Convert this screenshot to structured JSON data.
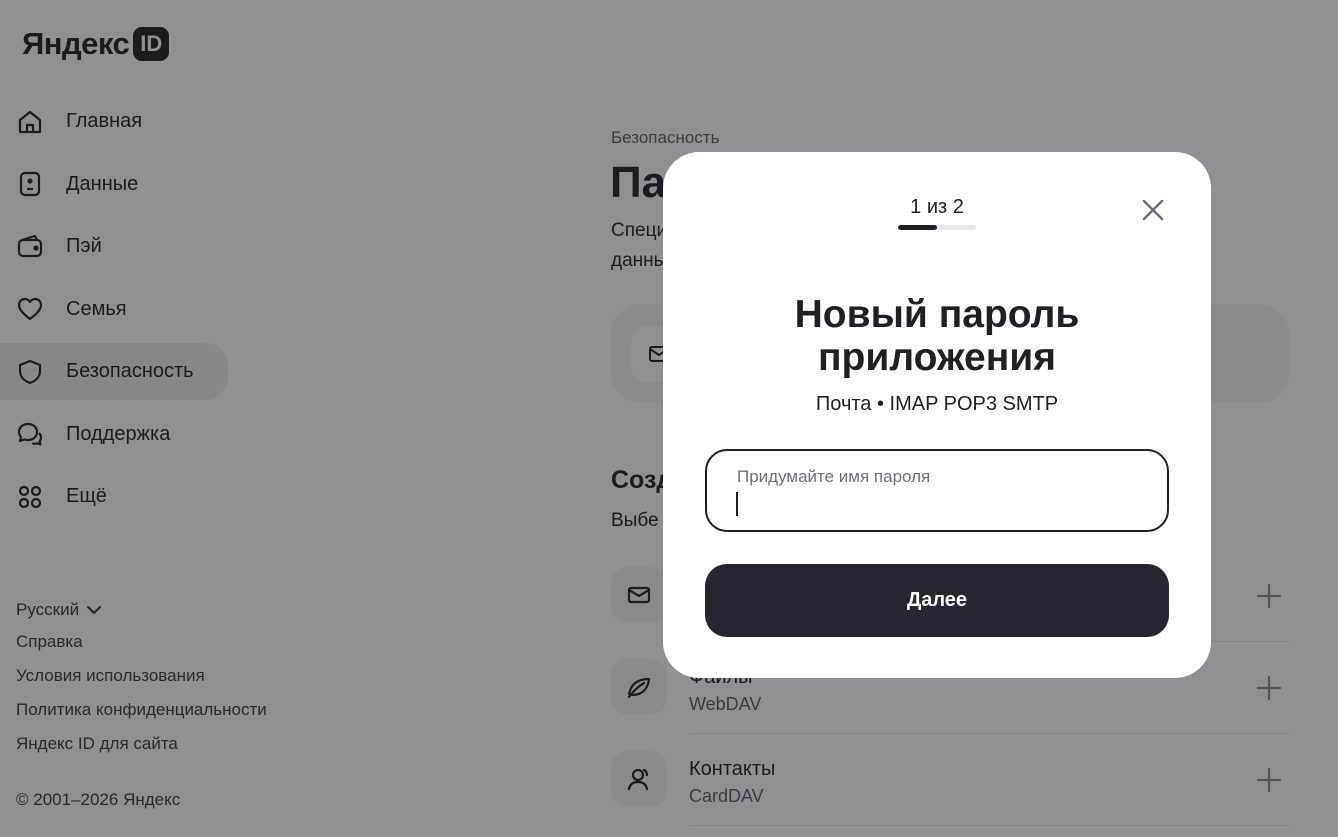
{
  "brand": {
    "wordmark": "Яндекс",
    "badge": "ID"
  },
  "sidebar": {
    "items": [
      {
        "label": "Главная",
        "icon": "home-icon",
        "active": false
      },
      {
        "label": "Данные",
        "icon": "id-card-icon",
        "active": false
      },
      {
        "label": "Пэй",
        "icon": "wallet-icon",
        "active": false
      },
      {
        "label": "Семья",
        "icon": "heart-icon",
        "active": false
      },
      {
        "label": "Безопасность",
        "icon": "shield-icon",
        "active": true
      },
      {
        "label": "Поддержка",
        "icon": "chat-icon",
        "active": false
      },
      {
        "label": "Ещё",
        "icon": "grid-icon",
        "active": false
      }
    ]
  },
  "footer": {
    "language": "Русский",
    "links": [
      "Справка",
      "Условия использования",
      "Политика конфиденциальности",
      "Яндекс ID для сайта"
    ],
    "copyright": "© 2001–2026 Яндекс"
  },
  "main": {
    "breadcrumb": "Безопасность",
    "title_partial": "Па",
    "desc_line1": "Специ",
    "desc_line2": "данны",
    "section_title_partial": "Созд",
    "section_sub_partial": "Выбе",
    "services": [
      {
        "title": "",
        "subtitle": "",
        "icon": "mail-icon"
      },
      {
        "title": "Файлы",
        "subtitle": "WebDAV",
        "icon": "leaf-icon"
      },
      {
        "title": "Контакты",
        "subtitle": "CardDAV",
        "icon": "contacts-icon"
      }
    ]
  },
  "modal": {
    "step_text": "1 из 2",
    "step_progress": 0.5,
    "title": "Новый пароль приложения",
    "subtitle": "Почта • IMAP POP3 SMTP",
    "input_label": "Придумайте имя пароля",
    "input_value": "",
    "button_label": "Далее"
  },
  "colors": {
    "overlay": "#161620",
    "primary_dark": "#272730",
    "muted_bg": "#f1f1f4"
  }
}
